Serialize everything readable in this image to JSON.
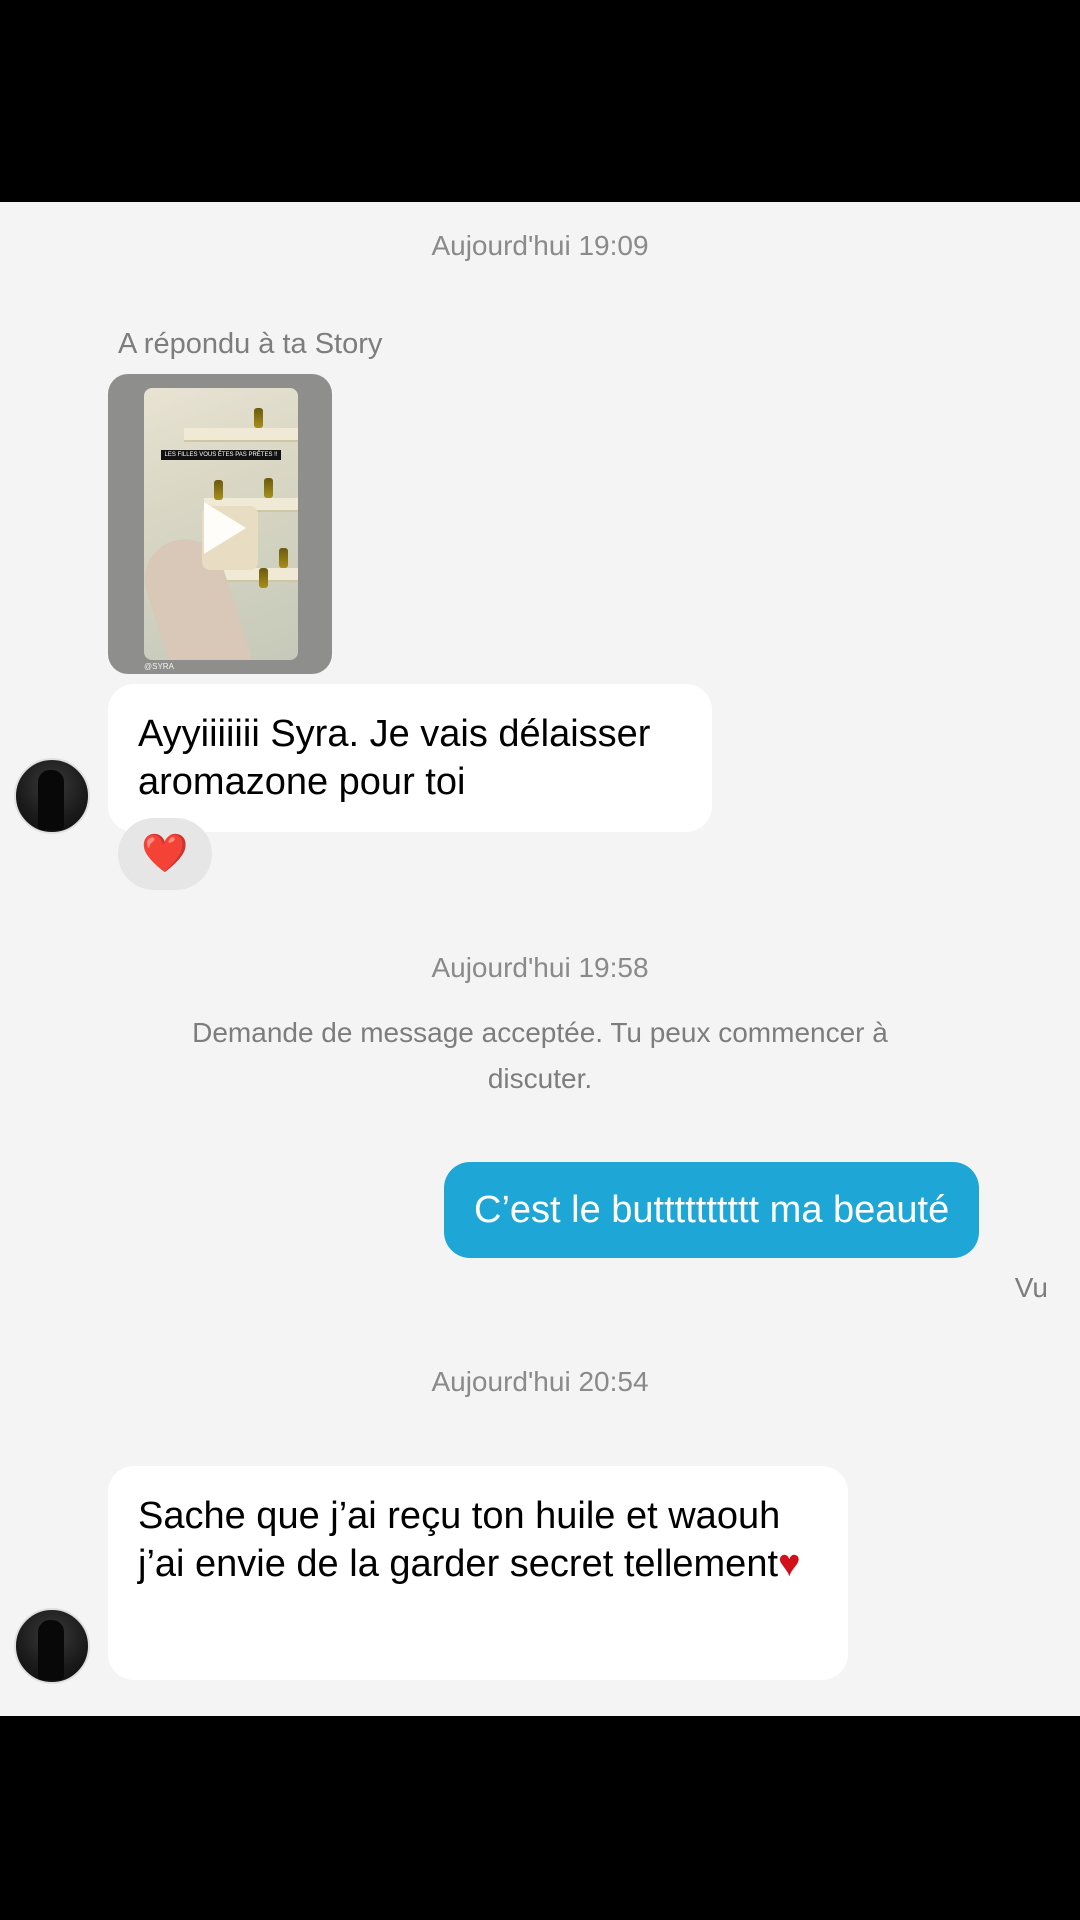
{
  "conversation": {
    "timestamp_1": "Aujourd'hui 19:09",
    "reply_label": "A répondu à ta Story",
    "story": {
      "caption": "LES FILLES VOUS ÊTES PAS PRÊTES !!",
      "handle": "@SYRA"
    },
    "message_1": "Ayyiiiiiii Syra. Je vais délaisser aromazone pour toi",
    "reaction_1": "❤️",
    "timestamp_2": "Aujourd'hui 19:58",
    "system_message": "Demande de message acceptée. Tu peux commencer à discuter.",
    "message_2": "C’est le butttttttttt ma beauté",
    "seen_label": "Vu",
    "timestamp_3": "Aujourd'hui 20:54",
    "message_3_text": "Sache que j’ai reçu ton huile et waouh j’ai envie de la garder secret tellement",
    "message_3_emoji": "♥"
  },
  "colors": {
    "outgoing_bubble": "#1ea7d6",
    "incoming_bubble": "#ffffff",
    "chat_background": "#f4f4f4"
  }
}
